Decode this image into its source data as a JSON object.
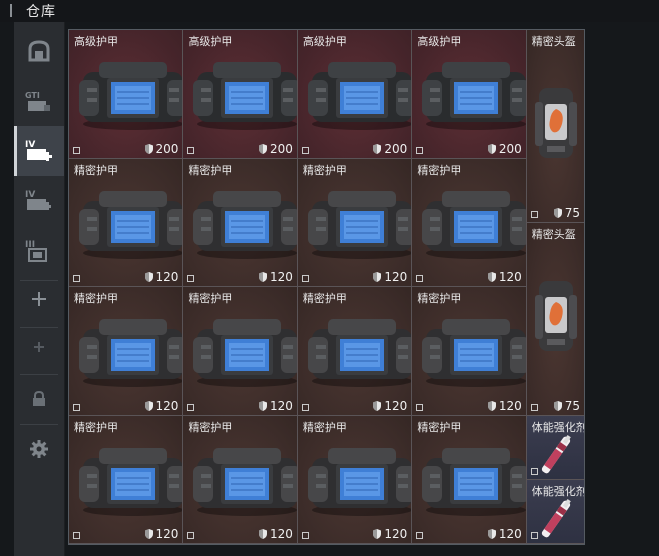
{
  "header": {
    "title": "仓库"
  },
  "sidebar": {
    "items": [
      {
        "icon": "bag-icon"
      },
      {
        "icon": "gti-box-icon",
        "label": "GTI"
      },
      {
        "icon": "tier-4-box-add-icon",
        "label": "IV",
        "active": true
      },
      {
        "icon": "tier-4-box-icon",
        "label": "IV"
      },
      {
        "icon": "tier-3-box-icon",
        "label": "III"
      },
      {
        "icon": "plus-icon"
      },
      {
        "icon": "plus-small-icon"
      },
      {
        "icon": "lock-icon"
      },
      {
        "icon": "gear-icon"
      }
    ]
  },
  "colors": {
    "red_tier": "#47252b",
    "brown_tier": "#3c2c29",
    "blue_tier": "#2e3142",
    "accent": "#d0d4d8"
  },
  "inventory": {
    "armor_rows": [
      [
        {
          "name": "高级护甲",
          "durability": "200",
          "tier": "red"
        },
        {
          "name": "高级护甲",
          "durability": "200",
          "tier": "red"
        },
        {
          "name": "高级护甲",
          "durability": "200",
          "tier": "red"
        },
        {
          "name": "高级护甲",
          "durability": "200",
          "tier": "red"
        }
      ],
      [
        {
          "name": "精密护甲",
          "durability": "120",
          "tier": "brown"
        },
        {
          "name": "精密护甲",
          "durability": "120",
          "tier": "brown"
        },
        {
          "name": "精密护甲",
          "durability": "120",
          "tier": "brown"
        },
        {
          "name": "精密护甲",
          "durability": "120",
          "tier": "brown"
        }
      ],
      [
        {
          "name": "精密护甲",
          "durability": "120",
          "tier": "brown"
        },
        {
          "name": "精密护甲",
          "durability": "120",
          "tier": "brown"
        },
        {
          "name": "精密护甲",
          "durability": "120",
          "tier": "brown"
        },
        {
          "name": "精密护甲",
          "durability": "120",
          "tier": "brown"
        }
      ],
      [
        {
          "name": "精密护甲",
          "durability": "120",
          "tier": "brown"
        },
        {
          "name": "精密护甲",
          "durability": "120",
          "tier": "brown"
        },
        {
          "name": "精密护甲",
          "durability": "120",
          "tier": "brown"
        },
        {
          "name": "精密护甲",
          "durability": "120",
          "tier": "brown"
        }
      ]
    ],
    "helmets": [
      {
        "name": "精密头盔",
        "durability": "75"
      },
      {
        "name": "精密头盔",
        "durability": "75"
      }
    ],
    "stimulants": [
      {
        "name": "体能强化剂"
      },
      {
        "name": "体能强化剂"
      }
    ]
  }
}
